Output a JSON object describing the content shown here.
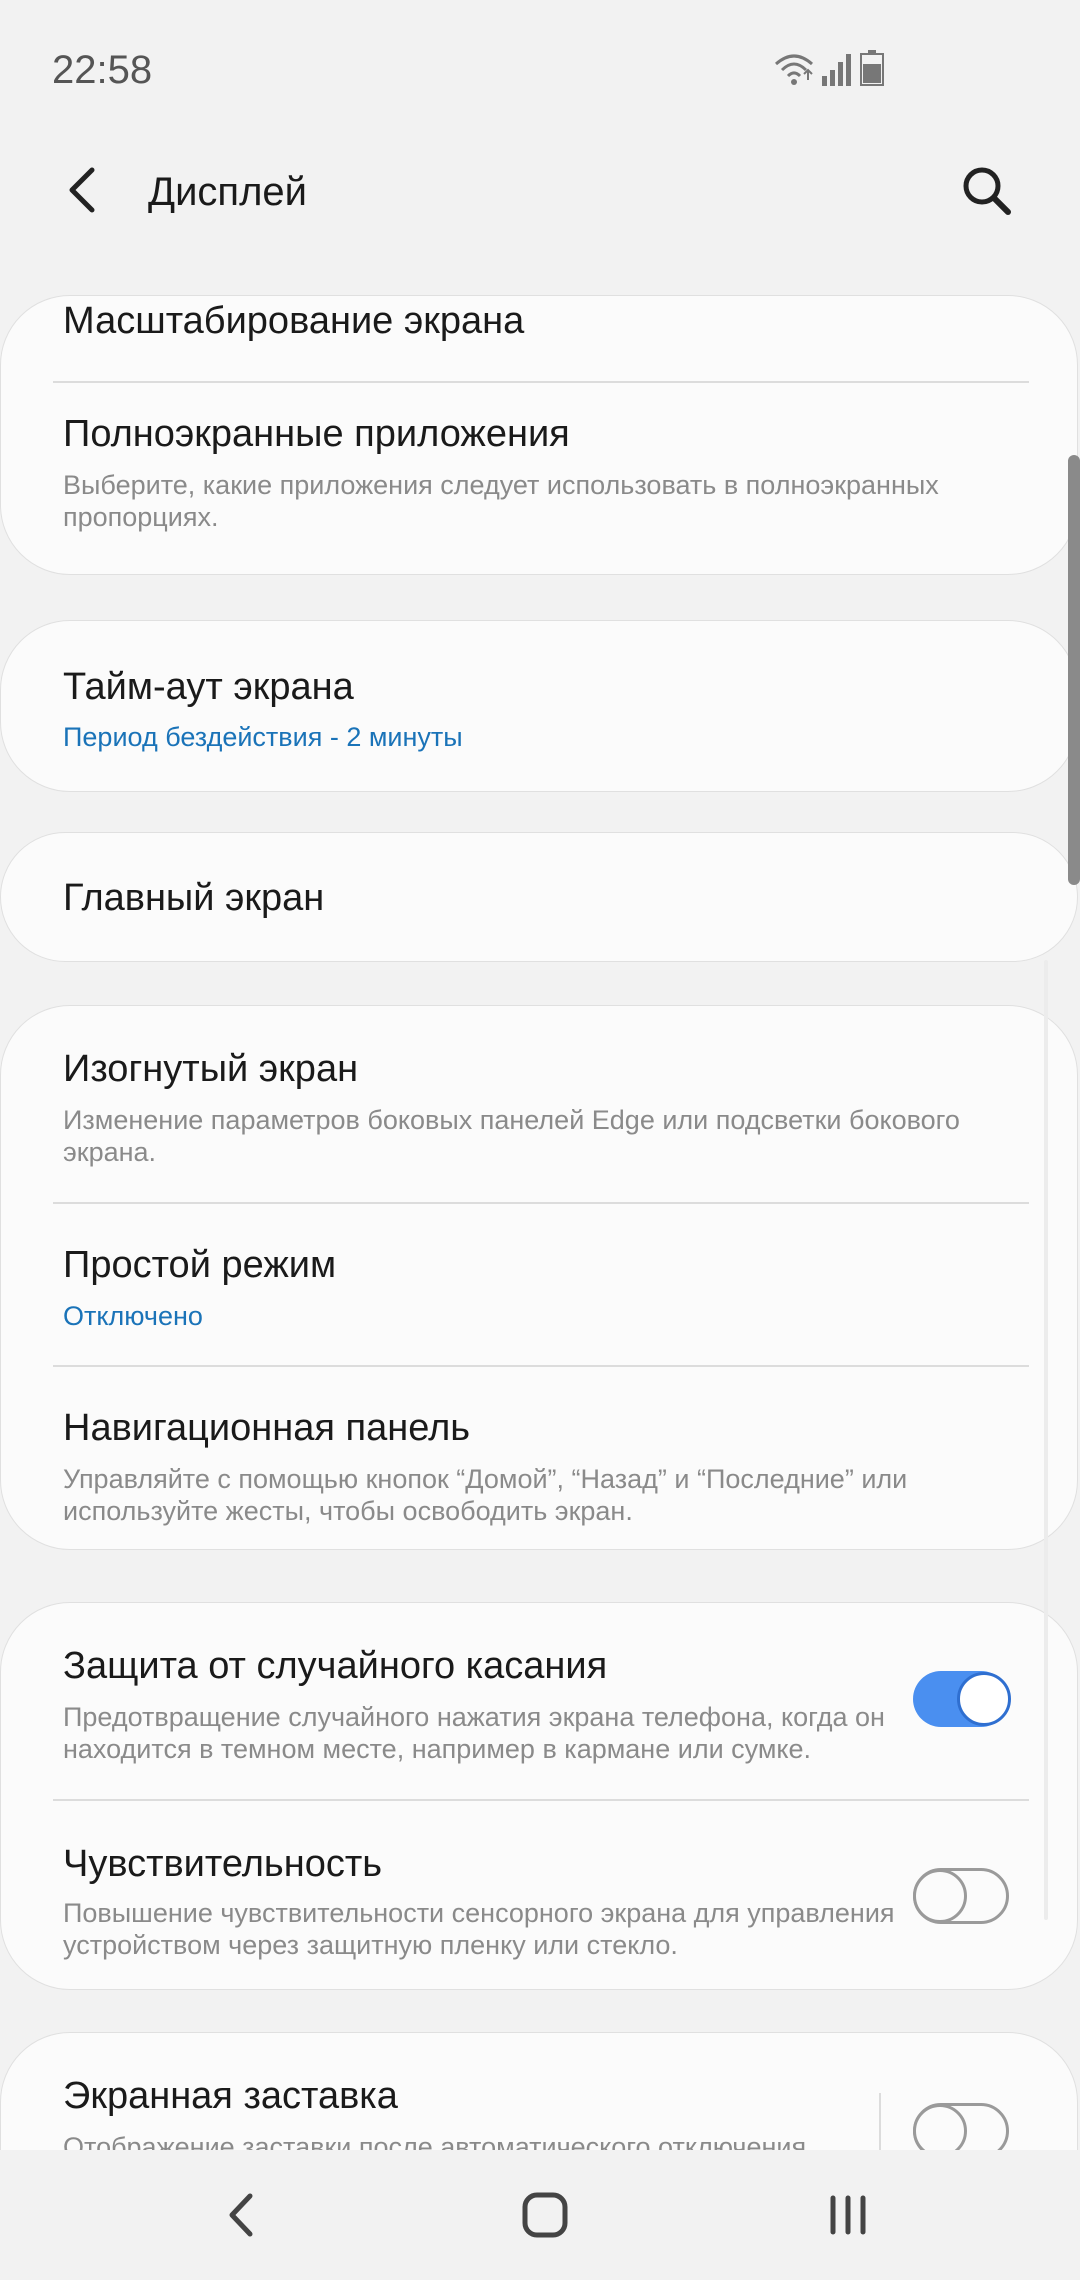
{
  "status_bar": {
    "time": "22:58"
  },
  "app_bar": {
    "title": "Дисплей"
  },
  "cards": {
    "display": {
      "screen_zoom_title": "Масштабирование экрана",
      "fullscreen_title": "Полноэкранные приложения",
      "fullscreen_subtitle": "Выберите, какие приложения следует использовать в полноэкранных пропорциях."
    },
    "timeout": {
      "title": "Тайм-аут экрана",
      "subtitle": "Период бездействия - 2 минуты"
    },
    "home": {
      "title": "Главный экран"
    },
    "misc": {
      "edge_title": "Изогнутый экран",
      "edge_subtitle": "Изменение параметров боковых панелей Edge или подсветки бокового экрана.",
      "easy_title": "Простой режим",
      "easy_subtitle": "Отключено",
      "nav_title": "Навигационная панель",
      "nav_subtitle": "Управляйте с помощью кнопок “Домой”, “Назад” и “Последние” или используйте жесты, чтобы освободить экран."
    },
    "touch": {
      "protect_title": "Защита от случайного касания",
      "protect_subtitle": "Предотвращение случайного нажатия экрана телефона, когда он находится в темном месте, например в кармане или сумке.",
      "protect_on": true,
      "sens_title": "Чувствительность",
      "sens_subtitle": "Повышение чувствительности сенсорного экрана для управления устройством через защитную пленку или стекло.",
      "sens_on": false
    },
    "screensaver": {
      "title": "Экранная заставка",
      "subtitle": "Отображение заставки после автоматического отключения",
      "on": false
    }
  },
  "colors": {
    "accent": "#4a8ff0",
    "link_blue": "#1a73b8",
    "background": "#f2f2f2",
    "card": "#fbfbfb"
  },
  "icons": {
    "back": "arrow-left-icon",
    "search": "search-icon",
    "wifi": "wifi-icon",
    "signal": "signal-icon",
    "battery": "battery-icon",
    "nav_back": "chevron-left-icon",
    "nav_home": "home-icon",
    "nav_recents": "recents-icon"
  }
}
